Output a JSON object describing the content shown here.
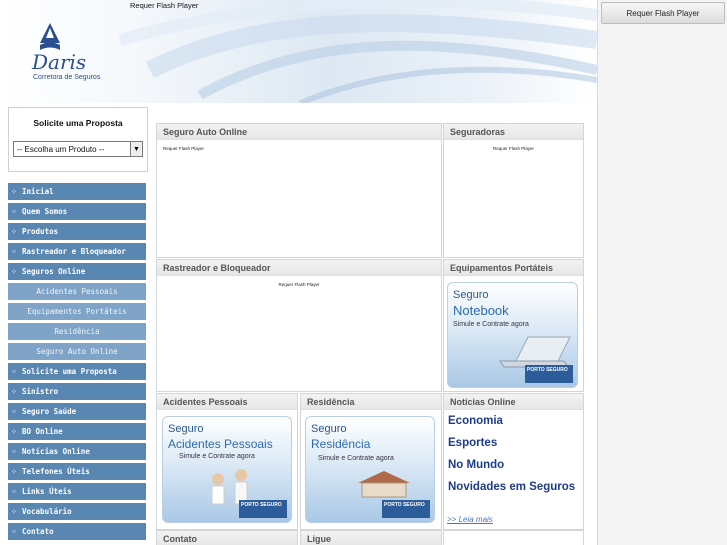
{
  "header": {
    "flash_text": "Requer Flash Player",
    "logo_name": "Daris",
    "logo_sub": "Corretora de Seguros"
  },
  "right_sidebar": {
    "flash_button": "Requer Flash Player"
  },
  "proposal_box": {
    "title": "Solicite uma Proposta",
    "select_value": "-- Escolha um Produto --"
  },
  "menu": [
    {
      "label": "Inicial",
      "sub": false
    },
    {
      "label": "Quem Somos",
      "sub": false
    },
    {
      "label": "Produtos",
      "sub": false
    },
    {
      "label": "Rastreador e Bloqueador",
      "sub": false
    },
    {
      "label": "Seguros Online",
      "sub": false
    },
    {
      "label": "Acidentes Pessoais",
      "sub": true
    },
    {
      "label": "Equipamentos Portáteis",
      "sub": true
    },
    {
      "label": "Residência",
      "sub": true
    },
    {
      "label": "Seguro Auto Online",
      "sub": true
    },
    {
      "label": "Solicite uma Proposta",
      "sub": false
    },
    {
      "label": "Sinistro",
      "sub": false
    },
    {
      "label": "Seguro Saúde",
      "sub": false
    },
    {
      "label": "BO Online",
      "sub": false
    },
    {
      "label": "Notícias Online",
      "sub": false
    },
    {
      "label": "Telefones Úteis",
      "sub": false
    },
    {
      "label": "Links Úteis",
      "sub": false
    },
    {
      "label": "Vocabulário",
      "sub": false
    },
    {
      "label": "Contato",
      "sub": false
    }
  ],
  "panels": {
    "auto": {
      "title": "Seguro Auto Online",
      "flash": "Requer Flash Player"
    },
    "seguradoras": {
      "title": "Seguradoras",
      "flash": "Requer Flash Player"
    },
    "rastreador": {
      "title": "Rastreador e Bloqueador",
      "flash": "Requer Flash Player"
    },
    "equipamentos": {
      "title": "Equipamentos Portáteis"
    },
    "acidentes": {
      "title": "Acidentes Pessoais"
    },
    "residencia": {
      "title": "Residência"
    },
    "noticias": {
      "title": "Notícias Online"
    },
    "contato": {
      "title": "Contato"
    },
    "ligue": {
      "title": "Ligue"
    }
  },
  "ads": {
    "notebook": {
      "line1": "Seguro",
      "line2": "Notebook",
      "line3": "Simule e Contrate agora",
      "brand": "PORTO SEGURO"
    },
    "acidentes": {
      "line1": "Seguro",
      "line2": "Acidentes Pessoais",
      "line3": "Simule e Contrate agora",
      "brand": "PORTO SEGURO"
    },
    "residencia": {
      "line1": "Seguro",
      "line2": "Residência",
      "line3": "Simule e Contrate agora",
      "brand": "PORTO SEGURO"
    }
  },
  "news": {
    "links": [
      "Economia",
      "Esportes",
      "No Mundo",
      "Novidades em Seguros"
    ],
    "more": ">> Leia mais"
  },
  "colors": {
    "menu_bg": "#5a86b2",
    "menu_sub_bg": "#7fa4c8",
    "link": "#1f3c8a"
  }
}
